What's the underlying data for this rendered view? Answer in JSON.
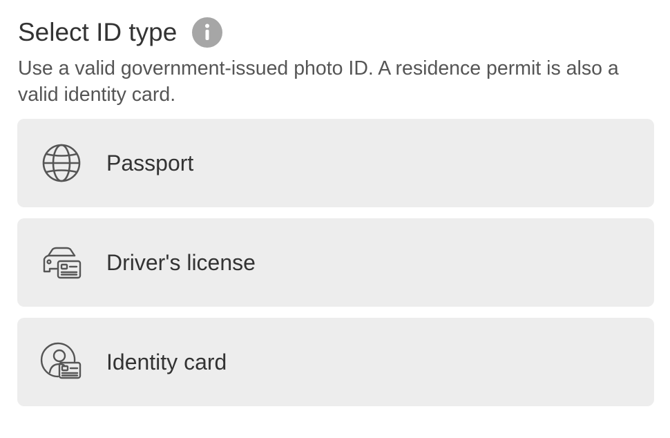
{
  "header": {
    "title": "Select ID type",
    "info_icon": "info-icon"
  },
  "subtitle": "Use a valid government-issued photo ID. A residence permit is also a valid identity card.",
  "options": [
    {
      "label": "Passport",
      "icon": "globe-icon"
    },
    {
      "label": "Driver's license",
      "icon": "car-license-icon"
    },
    {
      "label": "Identity card",
      "icon": "person-card-icon"
    }
  ],
  "colors": {
    "option_background": "#ededed",
    "text": "#333333",
    "info_icon": "#a6a6a6"
  }
}
